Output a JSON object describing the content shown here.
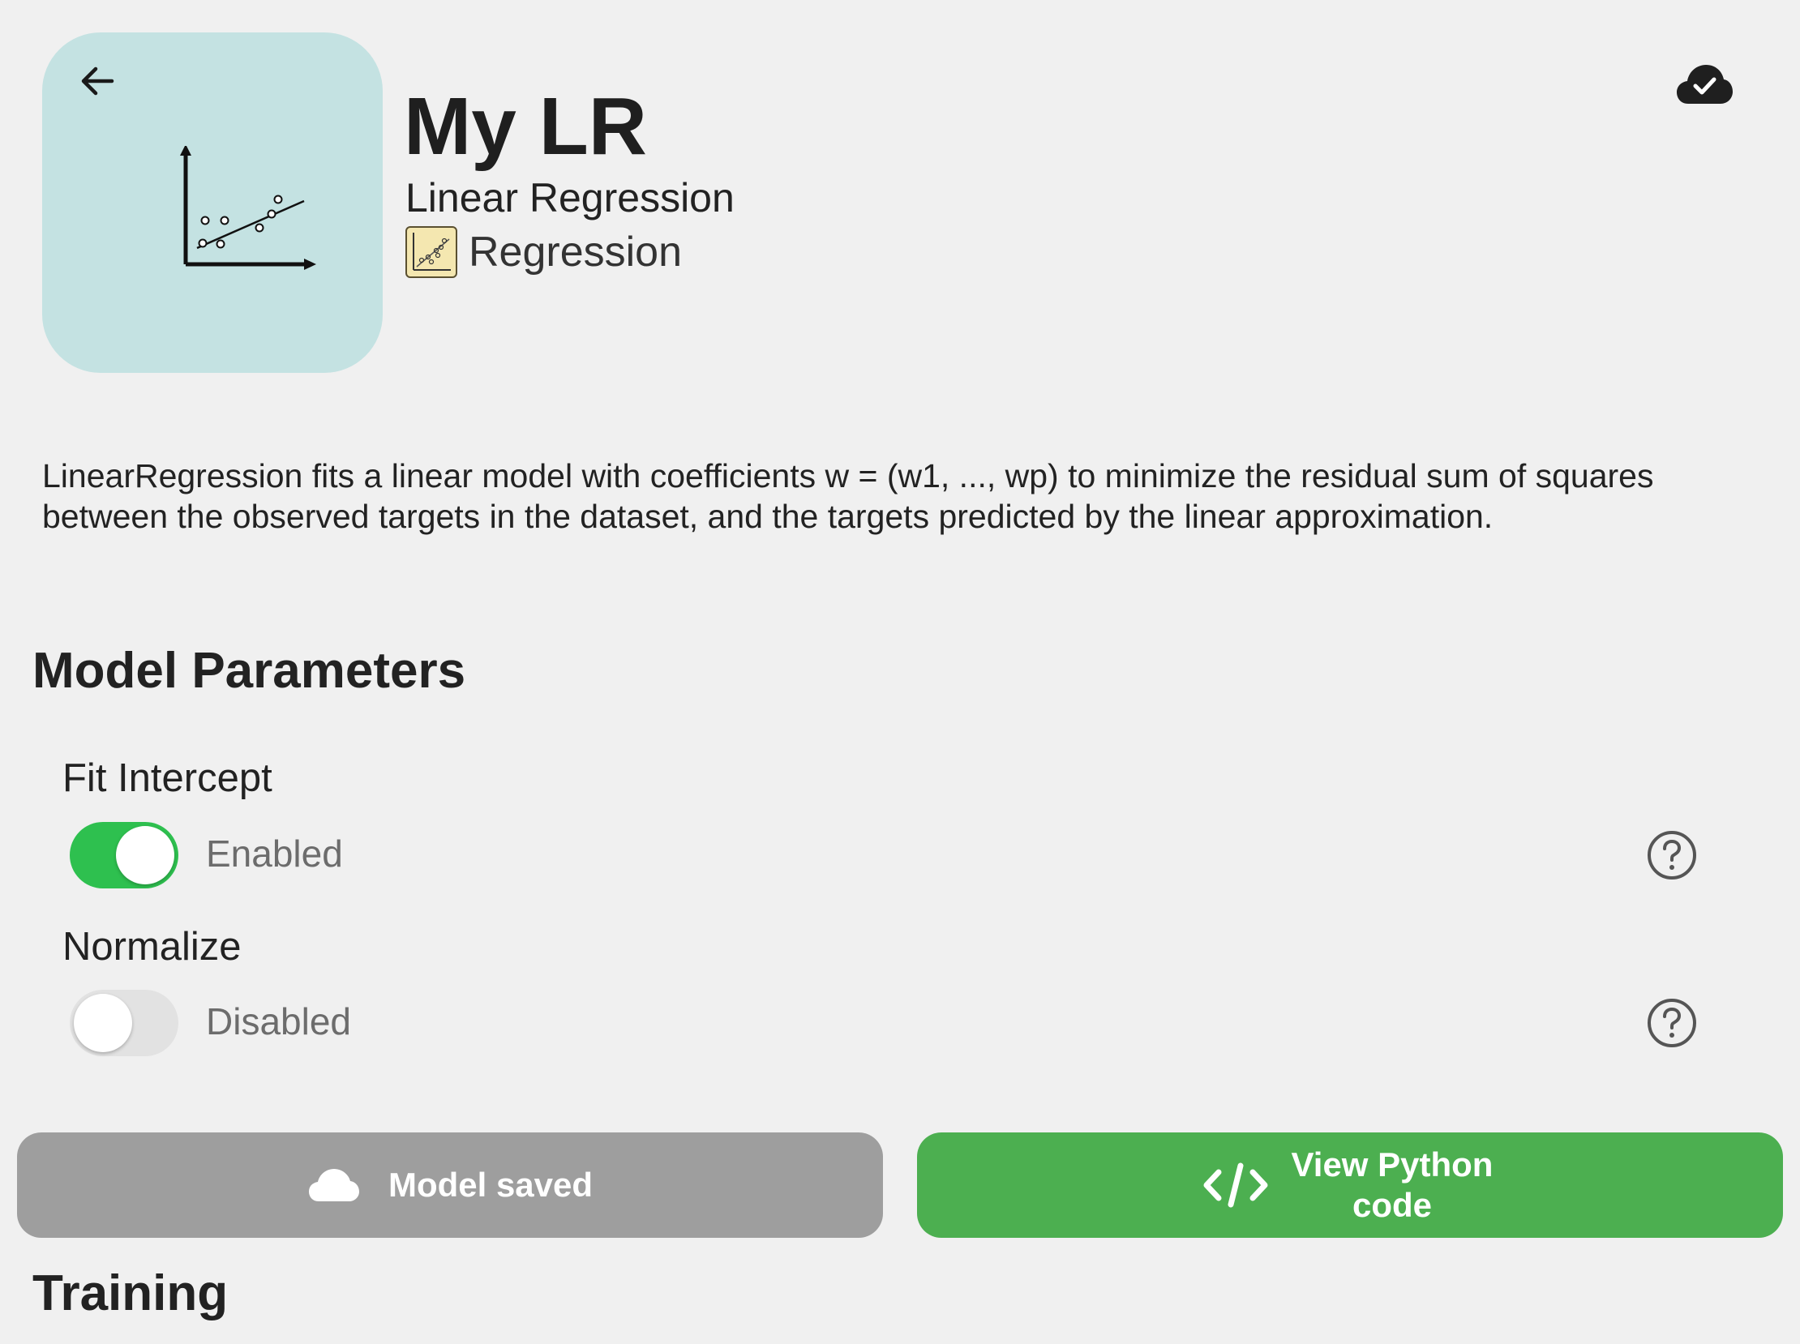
{
  "header": {
    "title": "My LR",
    "subtitle": "Linear Regression",
    "category": "Regression",
    "back_icon": "arrow-back-icon",
    "sync_icon": "cloud-check-icon",
    "hero_color": "#c4e2e2"
  },
  "description": "LinearRegression fits a linear model with coefficients w = (w1, ..., wp) to minimize the residual sum of squares between the observed targets in the dataset, and the targets predicted by the linear approximation.",
  "model_parameters": {
    "title": "Model Parameters",
    "params": [
      {
        "label": "Fit Intercept",
        "enabled": true,
        "status": "Enabled"
      },
      {
        "label": "Normalize",
        "enabled": false,
        "status": "Disabled"
      }
    ]
  },
  "actions": {
    "saved_label": "Model saved",
    "python_label": "View Python code",
    "saved_color": "#9e9e9e",
    "python_color": "#4caf50"
  },
  "training": {
    "title": "Training"
  }
}
